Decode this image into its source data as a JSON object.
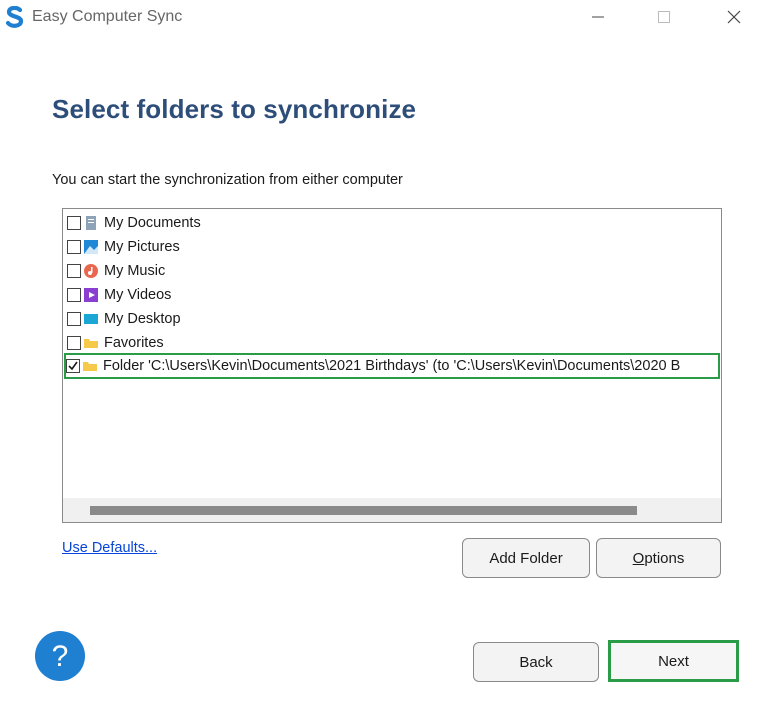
{
  "window": {
    "title": "Easy Computer Sync"
  },
  "page": {
    "heading": "Select folders to synchronize",
    "subtitle": "You can start the synchronization from either computer"
  },
  "folders": [
    {
      "label": "My Documents",
      "icon": "documents-icon",
      "checked": false
    },
    {
      "label": "My Pictures",
      "icon": "pictures-icon",
      "checked": false
    },
    {
      "label": "My Music",
      "icon": "music-icon",
      "checked": false
    },
    {
      "label": "My Videos",
      "icon": "videos-icon",
      "checked": false
    },
    {
      "label": "My Desktop",
      "icon": "desktop-icon",
      "checked": false
    },
    {
      "label": "Favorites",
      "icon": "folder-icon",
      "checked": false
    },
    {
      "label": "Folder 'C:\\Users\\Kevin\\Documents\\2021 Birthdays' (to 'C:\\Users\\Kevin\\Documents\\2020 B",
      "icon": "folder-icon",
      "checked": true
    }
  ],
  "actions": {
    "use_defaults": "Use Defaults...",
    "add_folder": "Add Folder",
    "options_prefix": "O",
    "options_rest": "ptions",
    "back": "Back",
    "next": "Next",
    "help": "?"
  },
  "colors": {
    "heading": "#2e4e7a",
    "highlight": "#2a9c47",
    "link": "#0645d8",
    "help_button": "#1f7fd1"
  }
}
